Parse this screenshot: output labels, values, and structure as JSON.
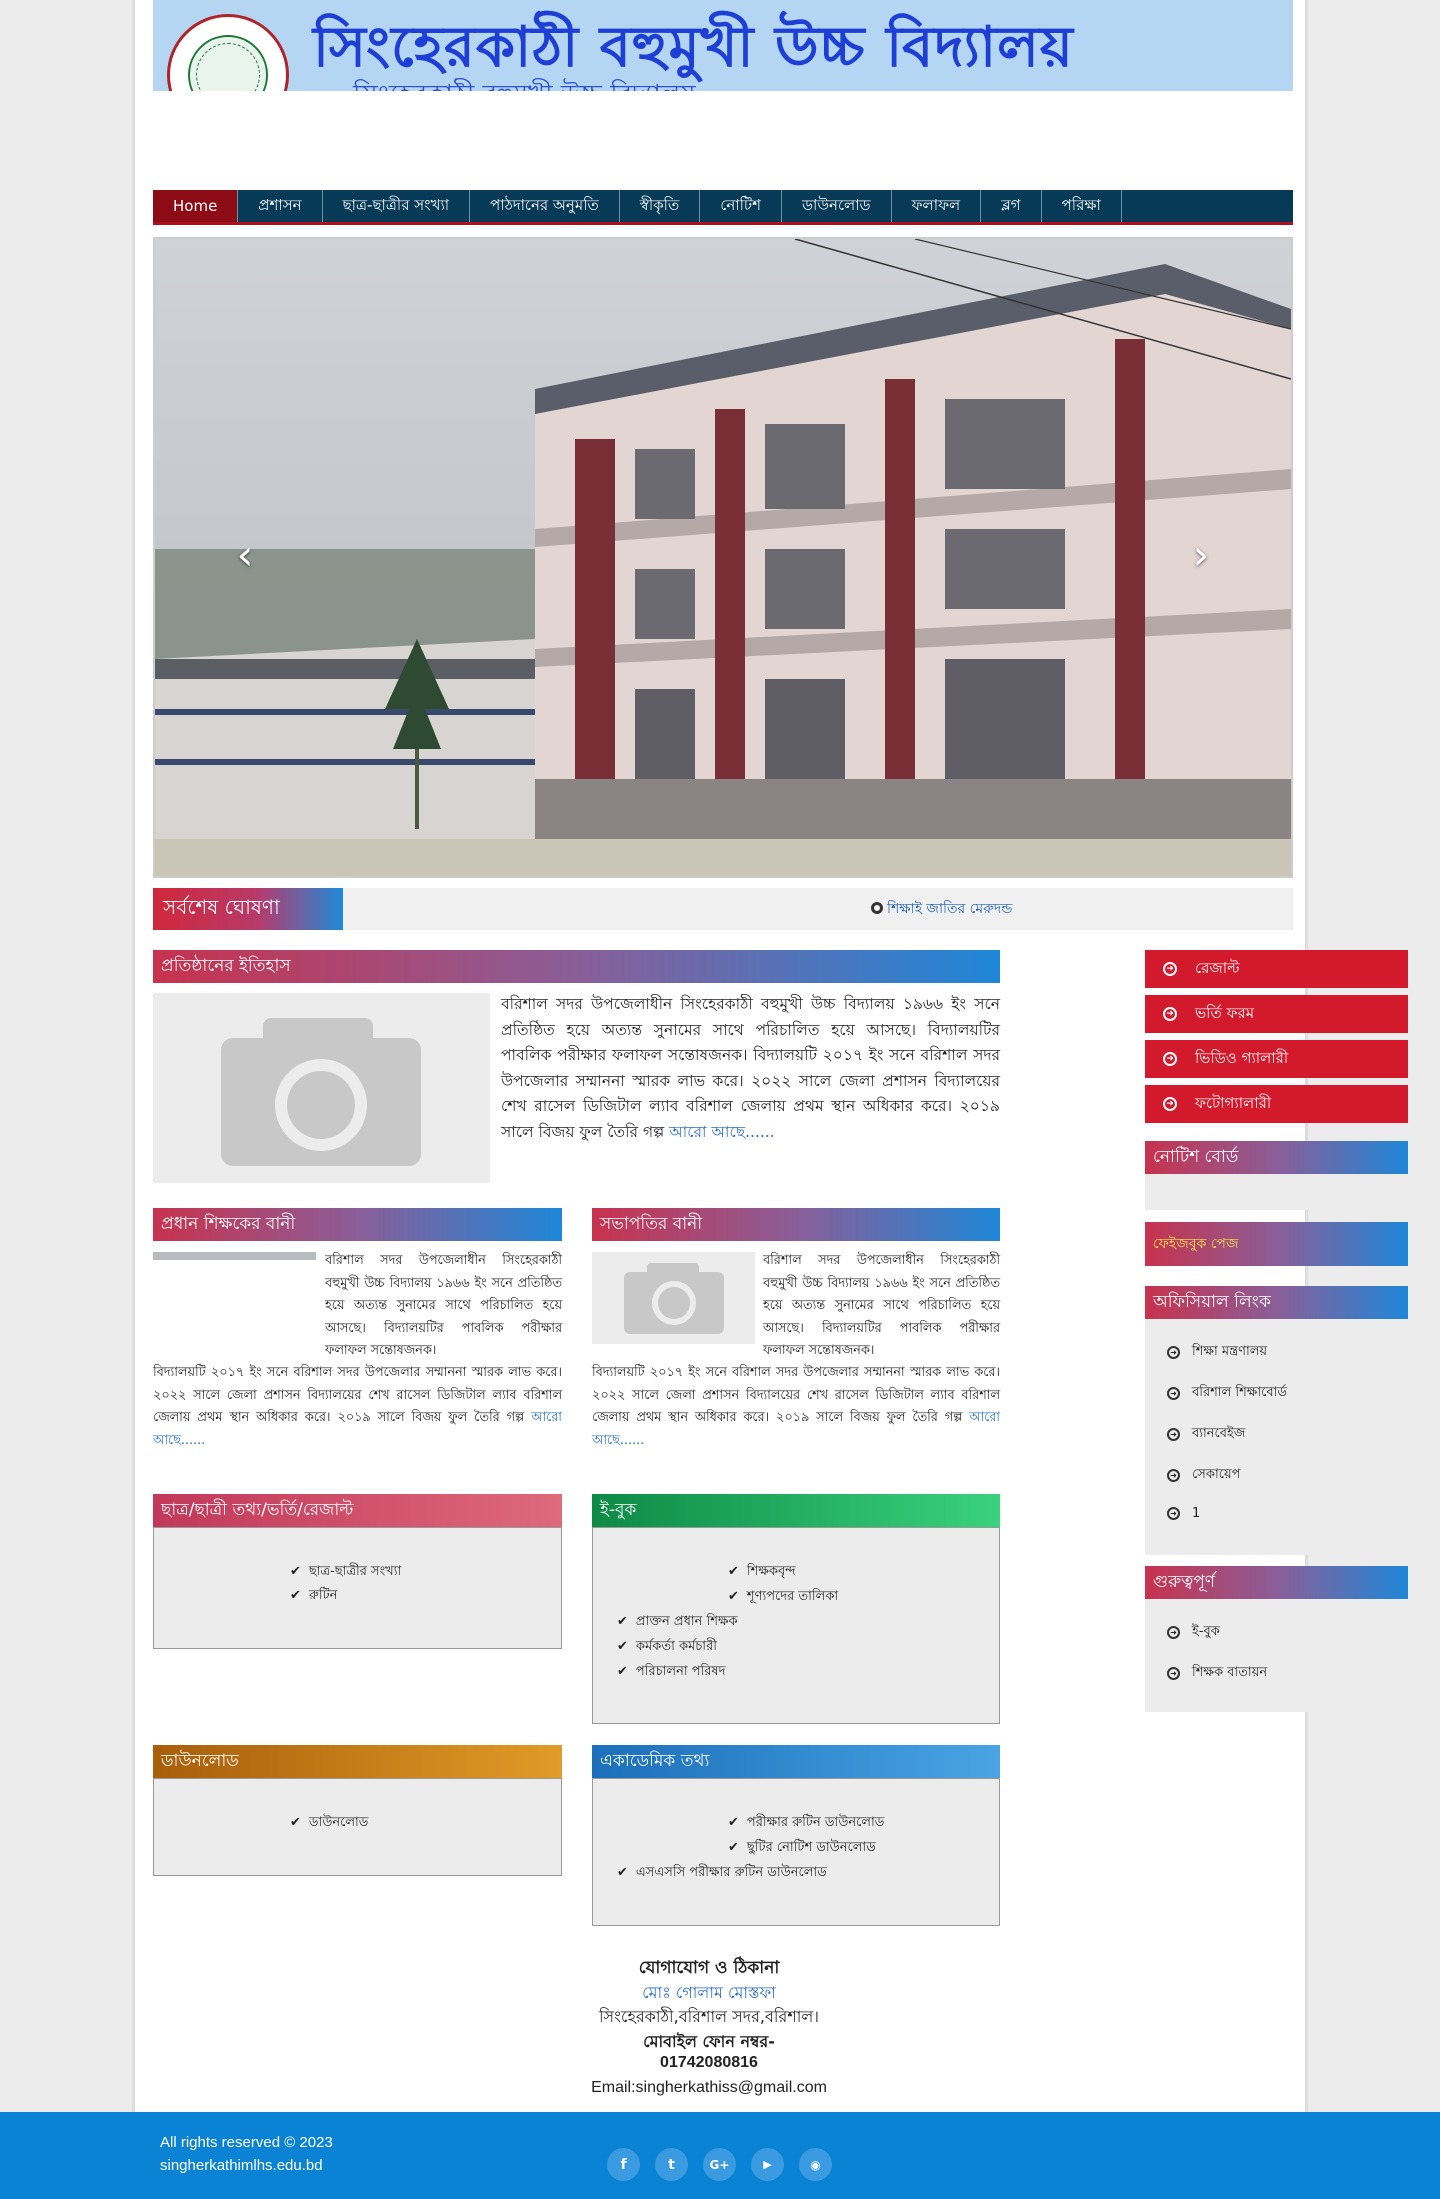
{
  "banner": {
    "title": "সিংহেরকাঠী বহুমুখী উচ্চ বিদ্যালয়",
    "subtitle": "সিংহেরকাঠী বহুমুখী উচ্চ বিদ্যালয়"
  },
  "nav": {
    "items": [
      "Home",
      "প্রশাসন",
      "ছাত্র-ছাত্রীর সংখ্যা",
      "পাঠদানের অনুমতি",
      "স্বীকৃতি",
      "নোটিশ",
      "ডাউনলোড",
      "ফলাফল",
      "ব্লগ",
      "পরিক্ষা"
    ]
  },
  "slider": {
    "prev": "‹",
    "next": "›"
  },
  "ticker": {
    "label": "সর্বশেষ ঘোষণা",
    "text": "শিক্ষাই জাতির মেরুদন্ড"
  },
  "history": {
    "title": "প্রতিষ্ঠানের ইতিহাস",
    "body": "বরিশাল সদর উপজেলাধীন সিংহেরকাঠী বহুমুখী উচ্চ বিদ্যালয় ১৯৬৬ ইং সনে প্রতিষ্ঠিত হয়ে অত্যন্ত সুনামের সাথে পরিচালিত হয়ে আসছে। বিদ্যালয়টির পাবলিক পরীক্ষার ফলাফল সন্তোষজনক। বিদ্যালয়টি ২০১৭ ইং সনে বরিশাল সদর উপজেলার সম্মাননা স্মারক লাভ করে। ২০২২ সালে জেলা প্রশাসন বিদ্যালয়ের শেখ রাসেল ডিজিটাল ল্যাব বরিশাল জেলায় প্রথম স্থান অধিকার করে। ২০১৯ সালে বিজয় ফুল তৈরি গল্প ",
    "more": "আরো আছে......"
  },
  "headmaster": {
    "title": "প্রধান শিক্ষকের বানী",
    "body": "বরিশাল সদর উপজেলাধীন সিংহেরকাঠী বহুমুখী উচ্চ বিদ্যালয় ১৯৬৬ ইং সনে প্রতিষ্ঠিত হয়ে অত্যন্ত সুনামের সাথে পরিচালিত হয়ে আসছে। বিদ্যালয়টির পাবলিক পরীক্ষার ফলাফল সন্তোষজনক।",
    "body2": "বিদ্যালয়টি ২০১৭ ইং সনে বরিশাল সদর উপজেলার সম্মাননা স্মারক লাভ করে। ২০২২ সালে জেলা প্রশাসন বিদ্যালয়ের শেখ রাসেল ডিজিটাল ল্যাব বরিশাল জেলায় প্রথম স্থান অধিকার করে। ২০১৯ সালে বিজয় ফুল তৈরি গল্প ",
    "more": "আরো আছে......"
  },
  "president": {
    "title": "সভাপতির বানী",
    "body": "বরিশাল সদর উপজেলাধীন সিংহেরকাঠী বহুমুখী উচ্চ বিদ্যালয় ১৯৬৬ ইং সনে প্রতিষ্ঠিত হয়ে অত্যন্ত সুনামের সাথে পরিচালিত হয়ে আসছে। বিদ্যালয়টির পাবলিক পরীক্ষার ফলাফল সন্তোষজনক।",
    "body2": "বিদ্যালয়টি ২০১৭ ইং সনে বরিশাল সদর উপজেলার সম্মাননা স্মারক লাভ করে। ২০২২ সালে জেলা প্রশাসন বিদ্যালয়ের শেখ রাসেল ডিজিটাল ল্যাব বরিশাল জেলায় প্রথম স্থান অধিকার করে। ২০১৯ সালে বিজয় ফুল তৈরি গল্প ",
    "more": "আরো আছে......"
  },
  "students": {
    "title": "ছাত্র/ছাত্রী তথ্য/ভর্তি/রেজাল্ট",
    "items": [
      "ছাত্র-ছাত্রীর সংখ্যা",
      "রুটিন"
    ]
  },
  "ebook": {
    "title": "ই-বুক",
    "items": [
      "শিক্ষকবৃন্দ",
      "শূণ্যপদের তালিকা",
      "প্রাক্তন প্রধান শিক্ষক",
      "কর্মকর্তা কর্মচারী",
      "পরিচালনা পরিষদ"
    ]
  },
  "download": {
    "title": "ডাউনলোড",
    "items": [
      "ডাউনলোড"
    ]
  },
  "academic": {
    "title": "একাডেমিক তথ্য",
    "items": [
      "পরীক্ষার রুটিন ডাউনলোড",
      "ছুটির নোটিশ ডাউনলোড",
      "এসএসসি পরীক্ষার রুটিন ডাউনলোড"
    ]
  },
  "sidebar": {
    "buttons": [
      "রেজাল্ট",
      "ভর্তি ফরম",
      "ভিডিও গ্যালারী",
      "ফটোগ্যালারী"
    ],
    "notice_title": "নোটিশ বোর্ড",
    "facebook_title": "ফেইজবুক পেজ",
    "official_title": "অফিসিয়াল লিংক",
    "official_links": [
      "শিক্ষা মন্ত্রণালয়",
      "বরিশাল শিক্ষাবোর্ড",
      "ব্যানবেইজ",
      "সেকায়েপ",
      "1"
    ],
    "important_title": "গুরুত্বপূর্ণ",
    "important_links": [
      "ই-বুক",
      "শিক্ষক বাতায়ন"
    ]
  },
  "contact": {
    "title": "যোগাযোগ ও ঠিকানা",
    "name": "মোঃ গোলাম মোস্তফা",
    "address": "সিংহেরকাঠী,বরিশাল সদর,বরিশাল।",
    "phone_label": "মোবাইল ফোন নম্বর-",
    "phone": "01742080816",
    "email": "Email:singherkathiss@gmail.com"
  },
  "footer": {
    "copyright": "All rights reserved © 2023",
    "site": "singherkathimlhs.edu.bd",
    "social": [
      "facebook-icon",
      "twitter-icon",
      "google-plus-icon",
      "youtube-icon",
      "rss-icon"
    ]
  },
  "colors": {
    "nav_bg": "#073a57",
    "nav_active": "#8d0b14",
    "side_button": "#d3192c",
    "footer_bg": "#0a83d5",
    "banner_bg": "#b4d6f2",
    "title_blue": "#1d3fd6"
  }
}
